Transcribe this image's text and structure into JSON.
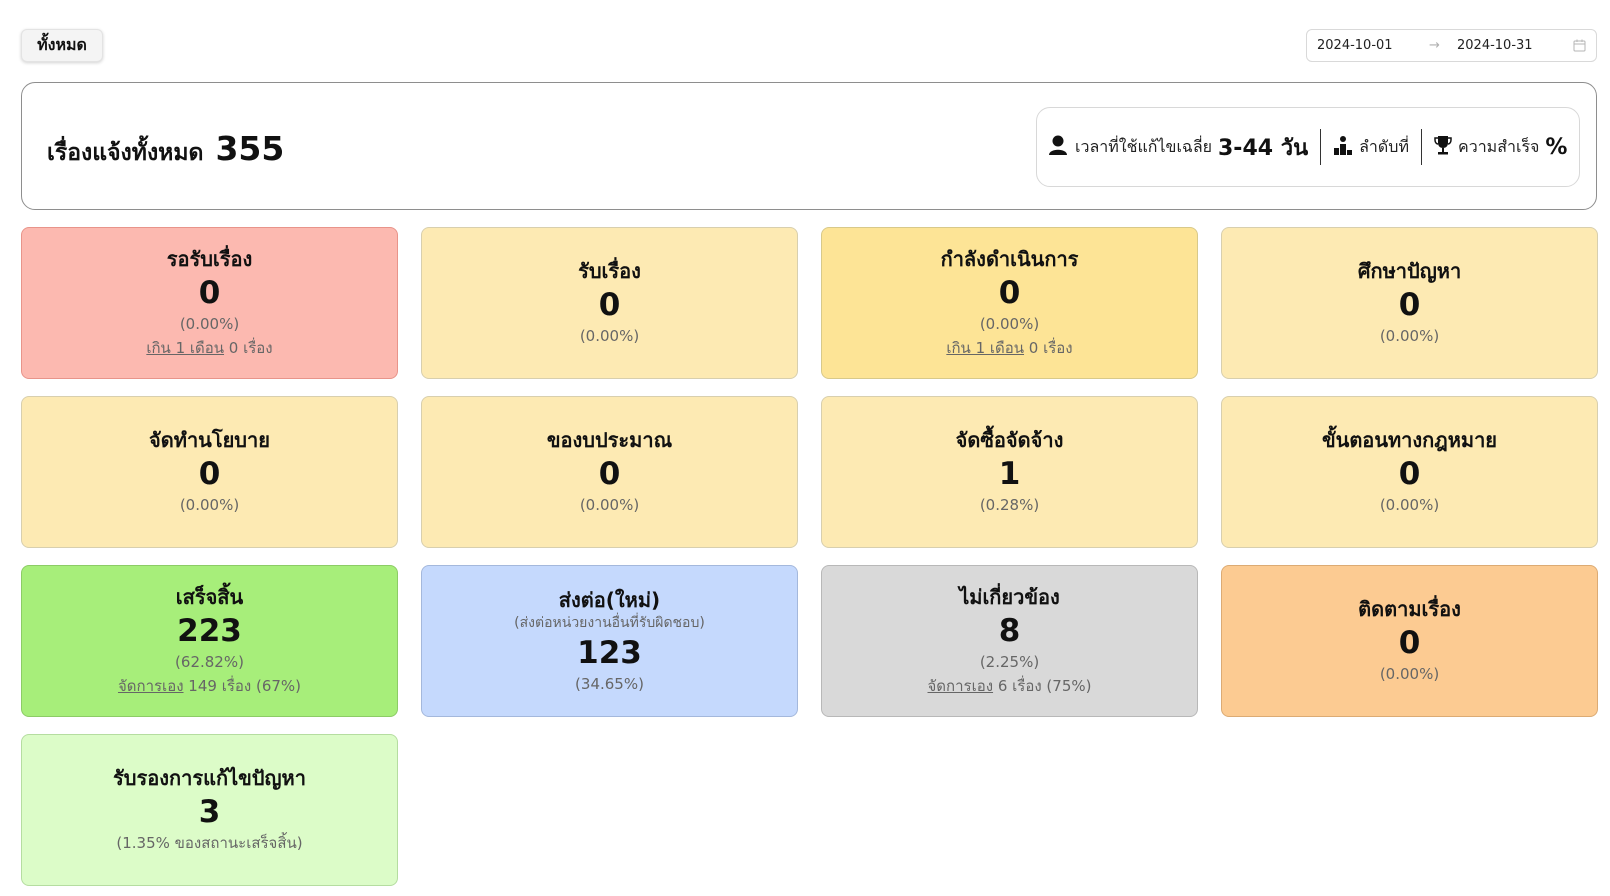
{
  "filter": {
    "all_label": "ทั้งหมด"
  },
  "date_range": {
    "start": "2024-10-01",
    "arrow": "→",
    "end": "2024-10-31"
  },
  "summary": {
    "label": "เรื่องแจ้งทั้งหมด",
    "total": "355",
    "avg_time_label": "เวลาที่ใช้แก้ไขเฉลี่ย",
    "avg_time_value": "3-44 วัน",
    "rank_label": "ลำดับที่",
    "success_label": "ความสำเร็จ",
    "success_value": "%"
  },
  "cards": [
    {
      "title": "รอรับเรื่อง",
      "value": "0",
      "pct": "(0.00%)",
      "extra_link": "เกิน 1 เดือน",
      "extra_text": " 0 เรื่อง",
      "bg": "#fcb9b0",
      "border": "#e8948a"
    },
    {
      "title": "รับเรื่อง",
      "value": "0",
      "pct": "(0.00%)",
      "bg": "#fdeab3",
      "border": "#d8cfae"
    },
    {
      "title": "กำลังดำเนินการ",
      "value": "0",
      "pct": "(0.00%)",
      "extra_link": "เกิน 1 เดือน",
      "extra_text": " 0 เรื่อง",
      "bg": "#fde496",
      "border": "#d8c98a"
    },
    {
      "title": "ศึกษาปัญหา",
      "value": "0",
      "pct": "(0.00%)",
      "bg": "#fdeab3",
      "border": "#d8cfae"
    },
    {
      "title": "จัดทำนโยบาย",
      "value": "0",
      "pct": "(0.00%)",
      "bg": "#fdeab3",
      "border": "#d8cfae"
    },
    {
      "title": "ของบประมาณ",
      "value": "0",
      "pct": "(0.00%)",
      "bg": "#fdeab3",
      "border": "#d8cfae"
    },
    {
      "title": "จัดซื้อจัดจ้าง",
      "value": "1",
      "pct": "(0.28%)",
      "bg": "#fdeab3",
      "border": "#d8cfae"
    },
    {
      "title": "ขั้นตอนทางกฎหมาย",
      "value": "0",
      "pct": "(0.00%)",
      "bg": "#fdeab3",
      "border": "#d8cfae"
    },
    {
      "title": "เสร็จสิ้น",
      "value": "223",
      "pct": "(62.82%)",
      "extra_link": "จัดการเอง",
      "extra_text": " 149 เรื่อง (67%)",
      "bg": "#a7ee7a",
      "border": "#8ccc66"
    },
    {
      "title": "ส่งต่อ(ใหม่)",
      "subtitle": "(ส่งต่อหน่วยงานอื่นที่รับผิดชอบ)",
      "value": "123",
      "pct": "(34.65%)",
      "bg": "#c5d9fd",
      "border": "#a4b8dc"
    },
    {
      "title": "ไม่เกี่ยวข้อง",
      "value": "8",
      "pct": "(2.25%)",
      "extra_link": "จัดการเอง",
      "extra_text": " 6 เรื่อง (75%)",
      "bg": "#d9d9d9",
      "border": "#b8b8b8"
    },
    {
      "title": "ติดตามเรื่อง",
      "value": "0",
      "pct": "(0.00%)",
      "bg": "#fccb92",
      "border": "#dcab74"
    },
    {
      "title": "รับรองการแก้ไขปัญหา",
      "value": "3",
      "pct": "(1.35% ของสถานะเสร็จสิ้น)",
      "bg": "#dcfcc8",
      "border": "#b5dda0"
    }
  ]
}
